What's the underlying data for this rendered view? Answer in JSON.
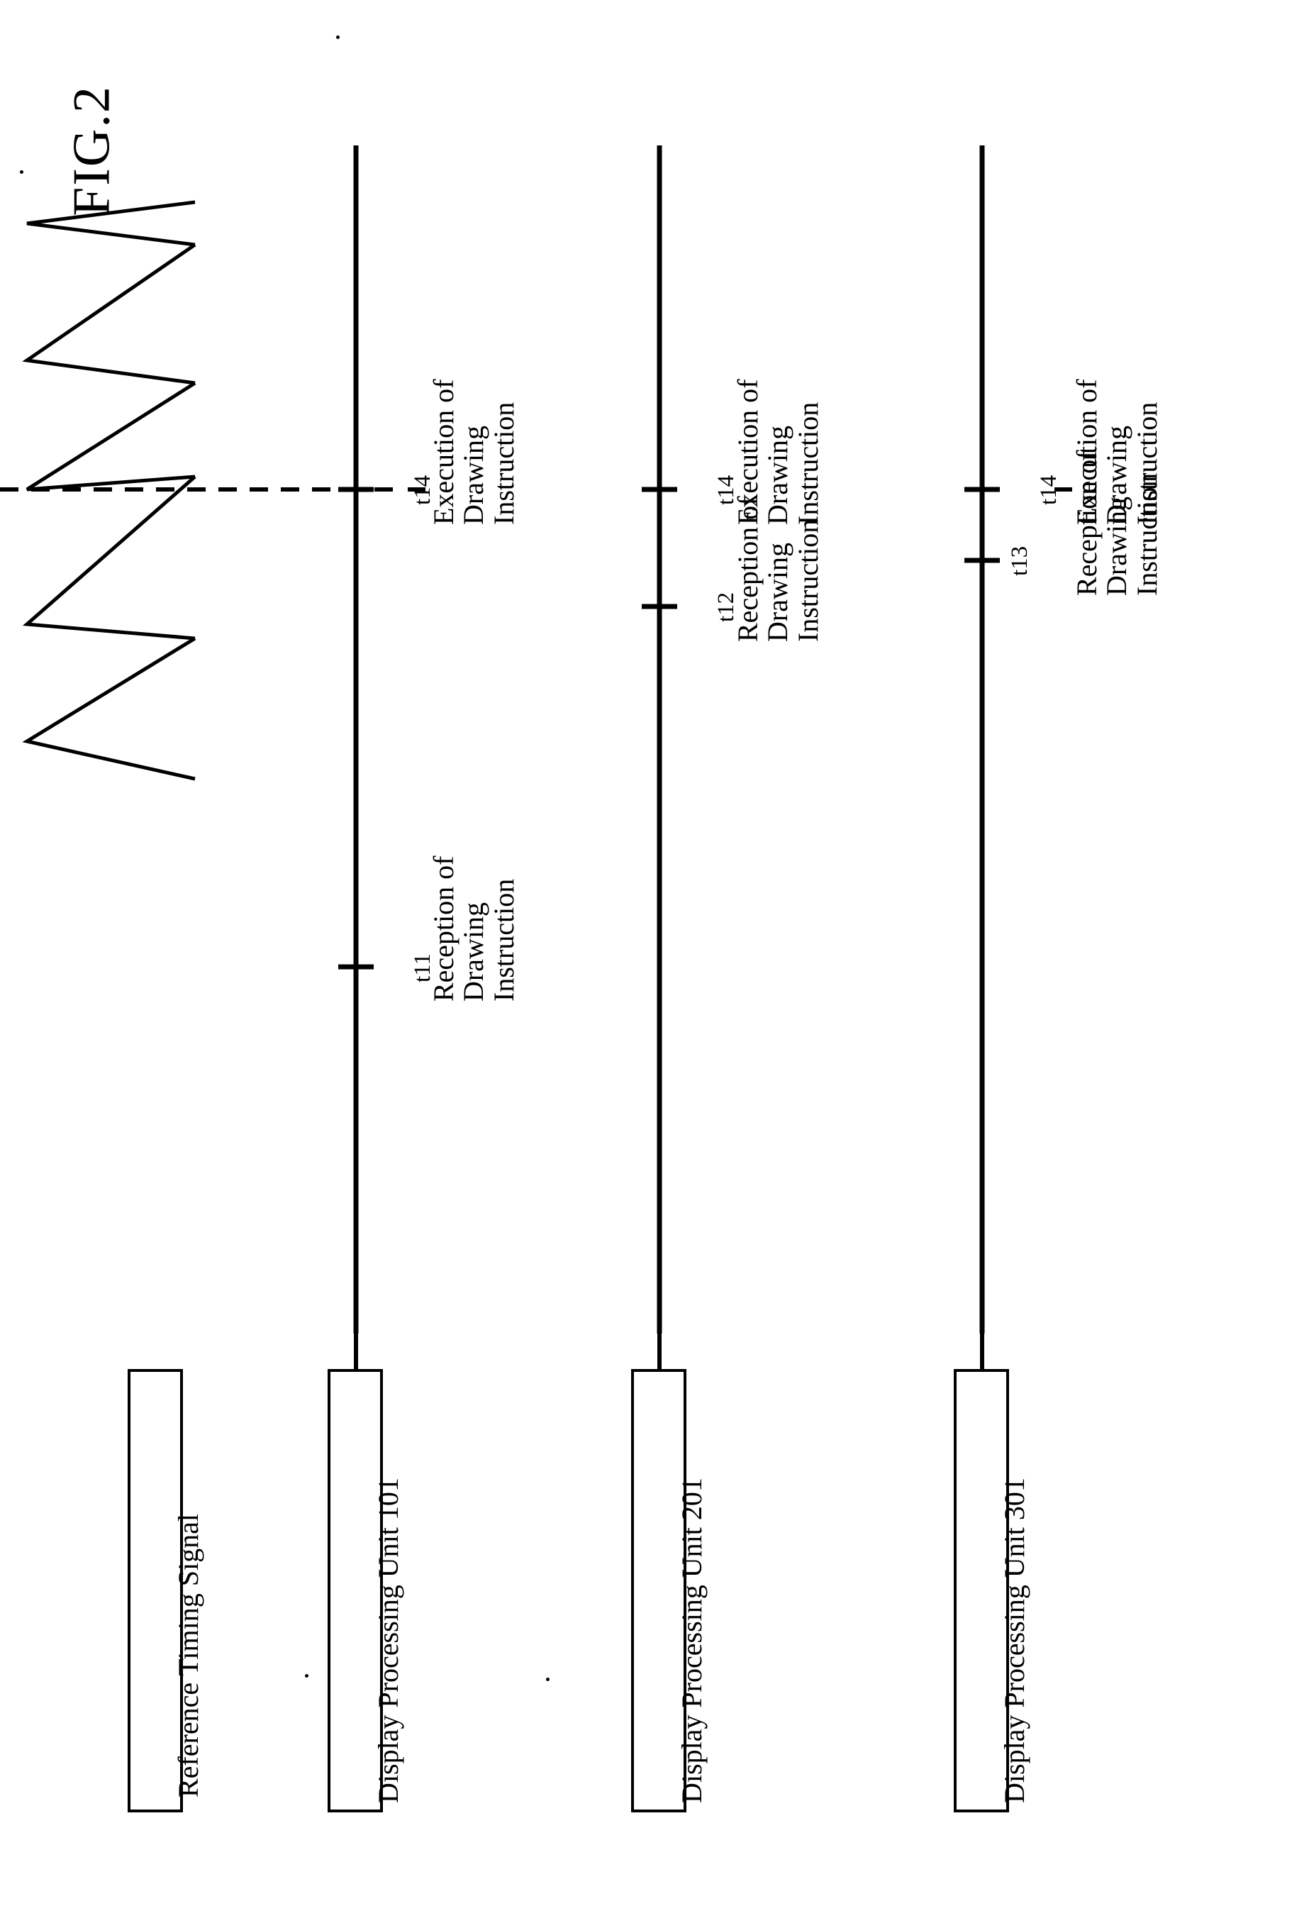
{
  "figure": {
    "title": "FIG.2",
    "type": "timing-diagram"
  },
  "boxes": [
    {
      "id": "reference-timing-signal",
      "label": "Reference Timing Signal"
    },
    {
      "id": "display-processing-unit-101",
      "label": "Display Processing Unit 101"
    },
    {
      "id": "display-processing-unit-201",
      "label": "Display Processing Unit 201"
    },
    {
      "id": "display-processing-unit-301",
      "label": "Display Processing Unit 301"
    }
  ],
  "timelines": [
    {
      "id": "timeline-101",
      "unit": "Display Processing Unit 101",
      "events": [
        {
          "tick": "t14",
          "line1": "Execution of",
          "line2": "Drawing",
          "line3": "Instruction"
        },
        {
          "tick": "t11",
          "line1": "Reception of",
          "line2": "Drawing",
          "line3": "Instruction"
        }
      ]
    },
    {
      "id": "timeline-201",
      "unit": "Display Processing Unit 201",
      "events": [
        {
          "tick": "t14",
          "line1": "Execution of",
          "line2": "Drawing",
          "line3": "Instruction"
        },
        {
          "tick": "t12",
          "line1": "Reception of",
          "line2": "Drawing",
          "line3": "Instruction"
        }
      ]
    },
    {
      "id": "timeline-301",
      "unit": "Display Processing Unit 301",
      "events": [
        {
          "tick": "t14",
          "line1": "Execution of",
          "line2": "Drawing",
          "line3": "Instruction"
        },
        {
          "tick": "t13",
          "line1": "Reception of",
          "line2": "Drawing",
          "line3": "Instruction"
        }
      ]
    }
  ],
  "waveform": {
    "name": "reference-timing-signal-waveform",
    "description": "sawtooth pulse train",
    "pulse_count": 4
  },
  "reference_line": {
    "name": "t14-reference-dashed-line",
    "style": "dashed"
  },
  "colors": {
    "ink": "#000000",
    "paper": "#ffffff"
  }
}
